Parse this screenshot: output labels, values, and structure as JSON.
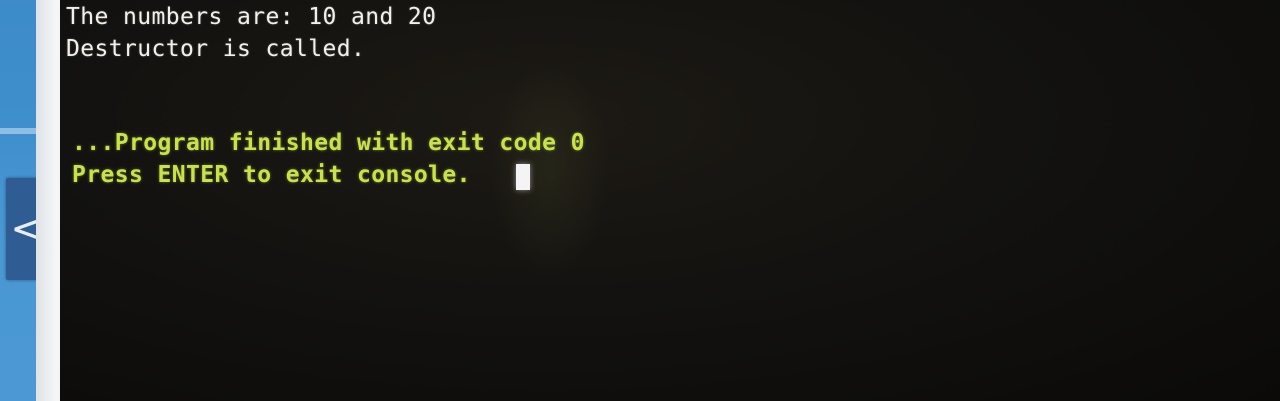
{
  "side_panel": {
    "collapse_icon": "chevron-left-icon",
    "collapse_glyph": "<"
  },
  "terminal": {
    "lines": [
      "The numbers are: 10 and 20",
      "Destructor is called.",
      "...Program finished with exit code 0",
      "Press ENTER to exit console."
    ]
  },
  "colors": {
    "output_text": "#f1f1ea",
    "status_text": "#c8e34a",
    "panel_blue": "#3f8fcd",
    "button_blue": "#2f5d93"
  }
}
